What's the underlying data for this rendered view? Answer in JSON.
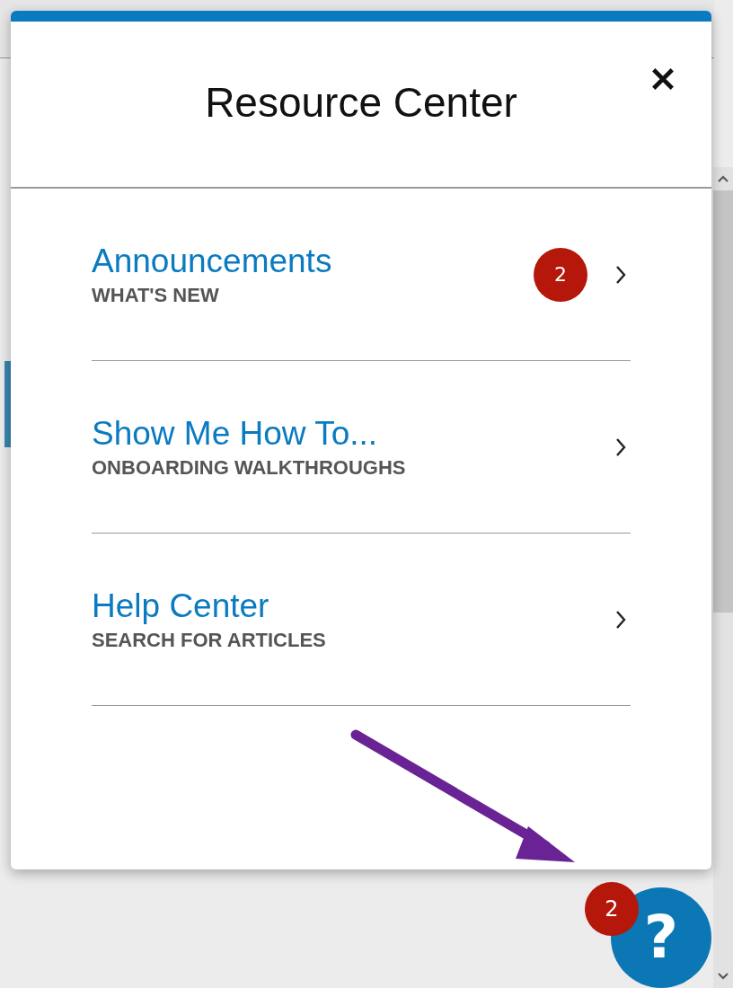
{
  "resource_center": {
    "title": "Resource Center",
    "items": [
      {
        "title": "Announcements",
        "subtitle": "WHAT'S NEW",
        "badge": "2"
      },
      {
        "title": "Show Me How To...",
        "subtitle": "ONBOARDING WALKTHROUGHS"
      },
      {
        "title": "Help Center",
        "subtitle": "SEARCH FOR ARTICLES"
      }
    ]
  },
  "help_button": {
    "label": "?",
    "badge": "2"
  }
}
